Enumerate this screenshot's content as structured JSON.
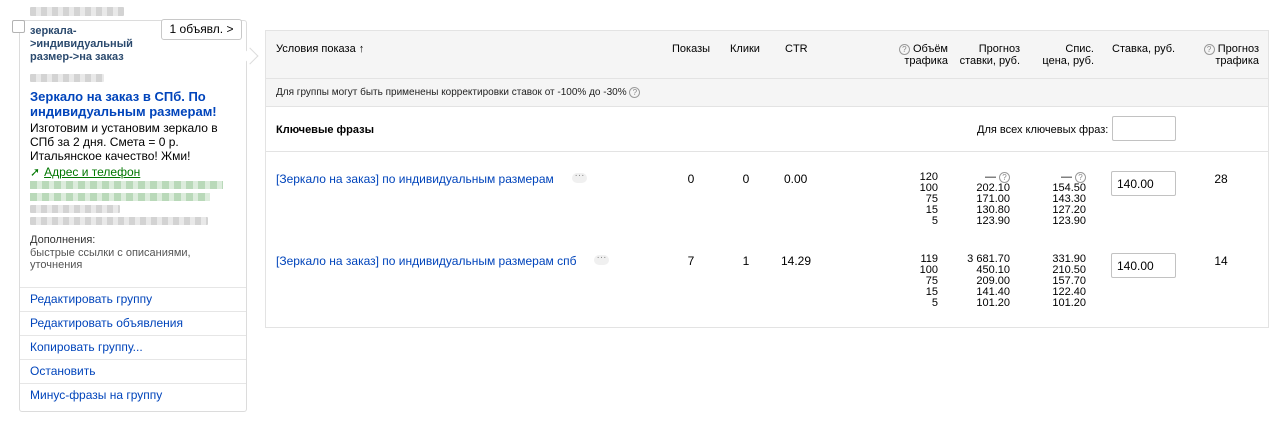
{
  "ad_card": {
    "ads_count_label": "1 объявл. >",
    "group_name": "зеркала->индивидуальный размер->на заказ",
    "ad_title": "Зеркало на заказ в СПб. По индивидуальным размерам!",
    "ad_text": "Изготовим и установим зеркало в СПб за 2 дня. Смета = 0 р. Итальянское качество! Жми!",
    "address_link": "Адрес и телефон",
    "addons_title": "Дополнения:",
    "addons_text": "быстрые ссылки с описаниями, уточнения",
    "menu": [
      {
        "label": "Редактировать группу"
      },
      {
        "label": "Редактировать объявления"
      },
      {
        "label": "Копировать группу..."
      },
      {
        "label": "Остановить"
      },
      {
        "label": "Минус-фразы на группу"
      }
    ]
  },
  "table": {
    "headers": {
      "conditions": "Условия показа ↑",
      "shows": "Показы",
      "clicks": "Клики",
      "ctr": "CTR",
      "traffic_volume": [
        "Объём",
        "трафика"
      ],
      "bid_forecast": [
        "Прогноз",
        "ставки, руб."
      ],
      "write_off_price": [
        "Спис.",
        "цена, руб."
      ],
      "bid": "Ставка, руб.",
      "traffic_forecast": [
        "Прогноз",
        "трафика"
      ]
    },
    "notice": "Для группы могут быть применены корректировки ставок от -100% до -30%",
    "keywords_title": "Ключевые фразы",
    "all_keywords_label": "Для всех ключевых фраз:",
    "rows": [
      {
        "phrase": "[Зеркало на заказ] по индивидуальным размерам",
        "shows": "0",
        "clicks": "0",
        "ctr": "0.00",
        "traffic_volumes": [
          "120",
          "100",
          "75",
          "15",
          "5"
        ],
        "bid_forecasts": [
          "—",
          "202.10",
          "171.00",
          "130.80",
          "123.90"
        ],
        "write_off_prices": [
          "—",
          "154.50",
          "143.30",
          "127.20",
          "123.90"
        ],
        "bid": "140.00",
        "traffic_forecast": "28"
      },
      {
        "phrase": "[Зеркало на заказ] по индивидуальным размерам спб",
        "shows": "7",
        "clicks": "1",
        "ctr": "14.29",
        "traffic_volumes": [
          "119",
          "100",
          "75",
          "15",
          "5"
        ],
        "bid_forecasts": [
          "3 681.70",
          "450.10",
          "209.00",
          "141.40",
          "101.20"
        ],
        "write_off_prices": [
          "331.90",
          "210.50",
          "157.70",
          "122.40",
          "101.20"
        ],
        "bid": "140.00",
        "traffic_forecast": "14"
      }
    ]
  },
  "icons": {
    "help_icon": "?",
    "more_icon": "···",
    "phone_arrow_icon": "➚"
  },
  "colors": {
    "link": "#0044bb",
    "green_link": "#007700",
    "header_bg": "#f5f5f5"
  }
}
